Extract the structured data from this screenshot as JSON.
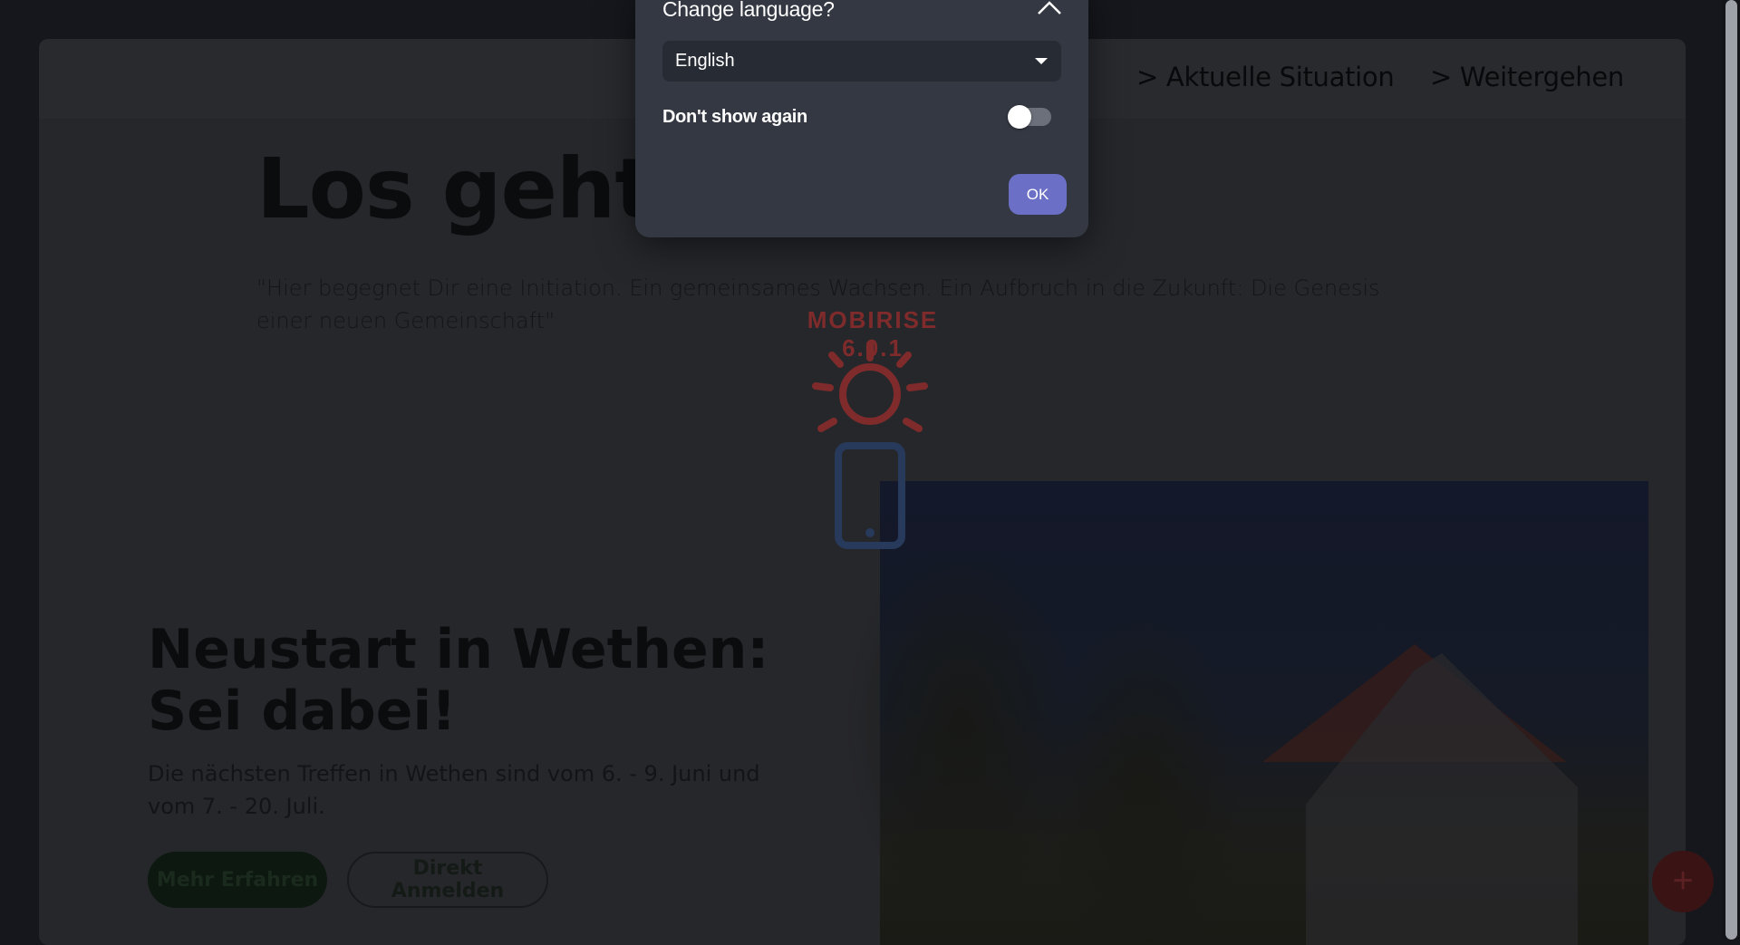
{
  "page": {
    "nav": {
      "items": [
        "> Aktuelle Situation",
        "> Weitergehen"
      ]
    },
    "hero": {
      "title": "Los geht’s … n!",
      "quote": "\"Hier begegnet Dir eine Initiation. Ein gemeinsames Wachsen. Ein Aufbruch in die Zukunft: Die Genesis einer neuen Gemeinschaft\""
    },
    "section": {
      "title_line1": "Neustart in Wethen:",
      "title_line2": "Sei dabei!",
      "text": "Die nächsten Treffen in Wethen sind vom 6. - 9. Juni und vom 7. - 20. Juli.",
      "primary_button": "Mehr Erfahren",
      "secondary_button": "Direkt Anmelden"
    },
    "fab_label": "+"
  },
  "loader": {
    "brand": "MOBIRISE 6.0.1"
  },
  "modal": {
    "title": "Change language?",
    "language": {
      "selected": "English"
    },
    "dont_show_label": "Don't show again",
    "dont_show_enabled": false,
    "ok_label": "OK"
  },
  "colors": {
    "modal_bg": "#343842",
    "select_bg": "#272b34",
    "ok_button": "#6b6fc6",
    "loader_accent": "#7f2b2b",
    "loader_device": "#283a5c"
  }
}
